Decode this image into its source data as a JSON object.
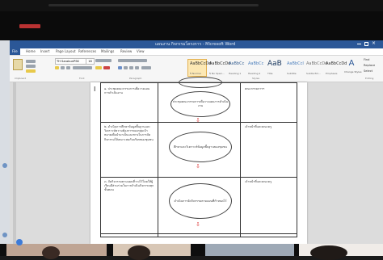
{
  "recording": {
    "label": "• REC"
  },
  "window": {
    "title": "แผนงาน กิจกรรมโครงการ - Microsoft Word"
  },
  "menu_tabs": [
    "File",
    "Home",
    "Insert",
    "Page Layout",
    "References",
    "Mailings",
    "Review",
    "View"
  ],
  "ribbon": {
    "font_name": "TH SarabunPSK",
    "font_size": "16",
    "styles": [
      {
        "preview": "AaBbCcDd",
        "name": "¶ Normal"
      },
      {
        "preview": "AaBbCcDd",
        "name": "¶ No Spaci..."
      },
      {
        "preview": "AaBbCc",
        "name": "Heading 1"
      },
      {
        "preview": "AaBbCc",
        "name": "Heading 2"
      },
      {
        "preview": "AaB",
        "name": "Title"
      },
      {
        "preview": "AaBbCcI",
        "name": "Subtitle"
      },
      {
        "preview": "AaBbCcDd",
        "name": "Subtle Em..."
      },
      {
        "preview": "AaBbCcDd",
        "name": "Emphasis"
      }
    ],
    "change_styles": "Change Styles",
    "editing": [
      "Find",
      "Replace",
      "Select"
    ],
    "group_labels": [
      "Clipboard",
      "Font",
      "Paragraph",
      "Styles",
      "Editing"
    ]
  },
  "document": {
    "row1": {
      "step": "๑. ประชุมคณะกรรมการเพื่อวางแผนการดำเนินงาน",
      "process": "ประชุมคณะกรรมการเพื่อวางแผนการดำเนินงาน",
      "owner": "คณะกรรมการฯ"
    },
    "row2": {
      "step": "๒. ดำเนินการศึกษาข้อมูลพื้นฐานและวิเคราะห์ความต้องการของกลุ่มเป้าหมายเพื่อนำมาเป็นแนวทางในการจัดกิจกรรมให้เหมาะสมกับบริบทของชุมชน",
      "process": "ศึกษาและวิเคราะห์ข้อมูลพื้นฐานของชุมชน",
      "owner": "เจ้าหน้าที่และคณะครู"
    },
    "row3": {
      "step": "๓. จัดกิจกรรมตามแผนที่วางไว้โดยให้ผู้เรียนมีส่วนร่วมในการดำเนินกิจกรรมทุกขั้นตอน",
      "process": "ดำเนินการจัดกิจกรรมตามแผนที่กำหนดไว้",
      "owner": "เจ้าหน้าที่และคณะครู"
    }
  },
  "colors": {
    "title_bar": "#2b5797",
    "flow_arrow": "#dd3333",
    "record_indicator": "#b93232"
  }
}
